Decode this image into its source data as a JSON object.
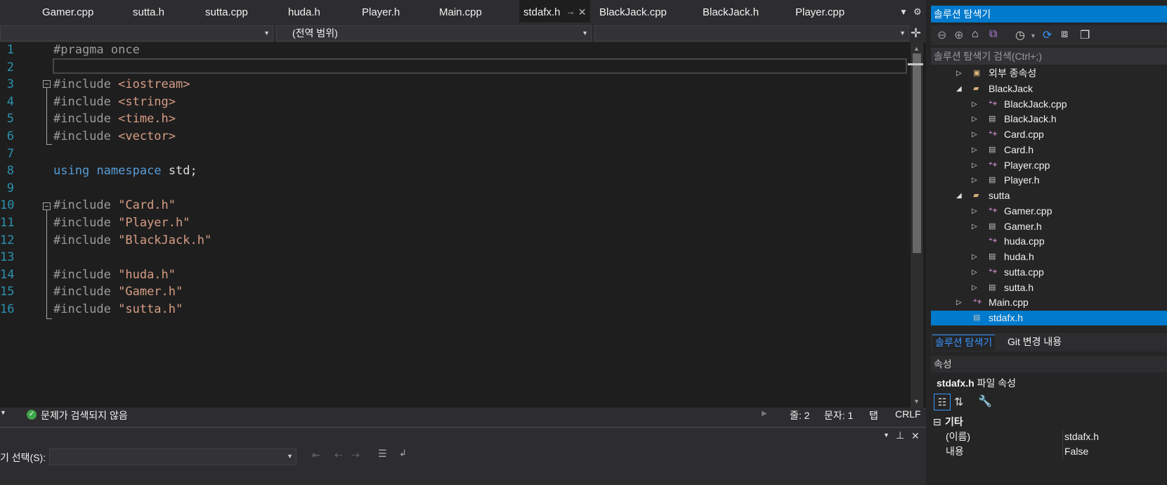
{
  "tabs": [
    {
      "label": "Gamer.cpp"
    },
    {
      "label": "sutta.h"
    },
    {
      "label": "sutta.cpp"
    },
    {
      "label": "huda.h"
    },
    {
      "label": "Player.h"
    },
    {
      "label": "Main.cpp"
    },
    {
      "label": "stdafx.h",
      "active": true
    },
    {
      "label": "BlackJack.cpp"
    },
    {
      "label": "BlackJack.h"
    },
    {
      "label": "Player.cpp"
    }
  ],
  "nav": {
    "scope_label": "(전역 범위)"
  },
  "editor": {
    "line_numbers": [
      "1",
      "2",
      "3",
      "4",
      "5",
      "6",
      "7",
      "8",
      "9",
      "10",
      "11",
      "12",
      "13",
      "14",
      "15",
      "16"
    ],
    "lines": [
      {
        "a": "#pragma once",
        "b": ""
      },
      {
        "a": "",
        "b": ""
      },
      {
        "a": "#include ",
        "b": "<iostream>"
      },
      {
        "a": "#include ",
        "b": "<string>"
      },
      {
        "a": "#include ",
        "b": "<time.h>"
      },
      {
        "a": "#include ",
        "b": "<vector>"
      },
      {
        "a": "",
        "b": ""
      },
      {
        "a": "using",
        "b": "namespace",
        "c": "std;"
      },
      {
        "a": "",
        "b": ""
      },
      {
        "a": "#include ",
        "b": "\"Card.h\""
      },
      {
        "a": "#include ",
        "b": "\"Player.h\""
      },
      {
        "a": "#include ",
        "b": "\"BlackJack.h\""
      },
      {
        "a": "",
        "b": ""
      },
      {
        "a": "#include ",
        "b": "\"huda.h\""
      },
      {
        "a": "#include ",
        "b": "\"Gamer.h\""
      },
      {
        "a": "#include ",
        "b": "\"sutta.h\""
      }
    ]
  },
  "status": {
    "issues": "문제가 검색되지 않음",
    "line": "줄: 2",
    "col": "문자: 1",
    "tab": "탭",
    "eol": "CRLF"
  },
  "bottom": {
    "select_label": "기 선택(S):"
  },
  "explorer": {
    "title": "솔루션 탐색기",
    "search_placeholder": "솔루션 탐색기 검색(Ctrl+;)",
    "items": [
      {
        "label": "외부 종속성",
        "type": "deps",
        "level": 0,
        "expander": "right"
      },
      {
        "label": "BlackJack",
        "type": "folder",
        "level": 0,
        "expander": "down"
      },
      {
        "label": "BlackJack.cpp",
        "type": "cpp",
        "level": 1,
        "expander": "right"
      },
      {
        "label": "BlackJack.h",
        "type": "h",
        "level": 1,
        "expander": "right"
      },
      {
        "label": "Card.cpp",
        "type": "cpp",
        "level": 1,
        "expander": "right"
      },
      {
        "label": "Card.h",
        "type": "h",
        "level": 1,
        "expander": "right"
      },
      {
        "label": "Player.cpp",
        "type": "cpp",
        "level": 1,
        "expander": "right"
      },
      {
        "label": "Player.h",
        "type": "h",
        "level": 1,
        "expander": "right"
      },
      {
        "label": "sutta",
        "type": "folder",
        "level": 0,
        "expander": "down"
      },
      {
        "label": "Gamer.cpp",
        "type": "cpp",
        "level": 1,
        "expander": "right"
      },
      {
        "label": "Gamer.h",
        "type": "h",
        "level": 1,
        "expander": "right"
      },
      {
        "label": "huda.cpp",
        "type": "cpp",
        "level": 1,
        "expander": "none"
      },
      {
        "label": "huda.h",
        "type": "h",
        "level": 1,
        "expander": "right"
      },
      {
        "label": "sutta.cpp",
        "type": "cpp",
        "level": 1,
        "expander": "right"
      },
      {
        "label": "sutta.h",
        "type": "h",
        "level": 1,
        "expander": "right"
      },
      {
        "label": "Main.cpp",
        "type": "cpp",
        "level": 0,
        "expander": "right"
      },
      {
        "label": "stdafx.h",
        "type": "h",
        "level": 0,
        "expander": "none",
        "selected": true
      }
    ],
    "tab_solution": "솔루션 탐색기",
    "tab_git": "Git 변경 내용"
  },
  "properties": {
    "title": "속성",
    "file_name": "stdafx.h",
    "file_kind": "파일 속성",
    "category": "기타",
    "rows": [
      {
        "name": "(이름)",
        "value": "stdafx.h"
      },
      {
        "name": "내용",
        "value": "False"
      }
    ]
  },
  "colors": {
    "accent": "#007acc",
    "editor_bg": "#1e1e1e",
    "string": "#d69d85",
    "keyword": "#569cd6",
    "preprocessor": "#9b9b9b",
    "line_number": "#2b91af"
  }
}
